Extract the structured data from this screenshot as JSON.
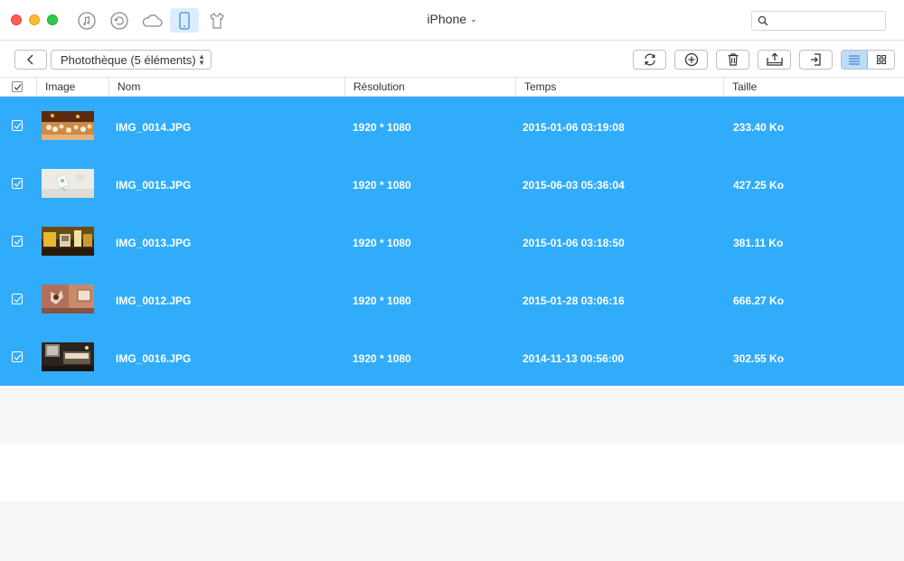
{
  "window": {
    "device_title": "iPhone",
    "search": {
      "placeholder": "",
      "value": ""
    },
    "nav_icons": [
      "itunes-icon",
      "restore-icon",
      "icloud-icon",
      "iphone-icon",
      "tshirt-icon"
    ],
    "active_nav": "iphone-icon"
  },
  "toolbar": {
    "library_selector": "Photothèque (5 éléments)",
    "buttons": [
      "back-icon",
      "refresh-icon",
      "add-icon",
      "trash-icon",
      "export-to-computer-icon",
      "import-icon",
      "list-view-icon",
      "grid-view-icon"
    ],
    "active_view": "list"
  },
  "table": {
    "columns": {
      "image": "Image",
      "name": "Nom",
      "resolution": "Résolution",
      "time": "Temps",
      "size": "Taille"
    },
    "all_selected": true,
    "rows": [
      {
        "name": "IMG_0014.JPG",
        "resolution": "1920 * 1080",
        "time": "2015-01-06 03:19:08",
        "size": "233.40 Ko",
        "selected": true
      },
      {
        "name": "IMG_0015.JPG",
        "resolution": "1920 * 1080",
        "time": "2015-06-03 05:36:04",
        "size": "427.25 Ko",
        "selected": true
      },
      {
        "name": "IMG_0013.JPG",
        "resolution": "1920 * 1080",
        "time": "2015-01-06 03:18:50",
        "size": "381.11 Ko",
        "selected": true
      },
      {
        "name": "IMG_0012.JPG",
        "resolution": "1920 * 1080",
        "time": "2015-01-28 03:06:16",
        "size": "666.27 Ko",
        "selected": true
      },
      {
        "name": "IMG_0016.JPG",
        "resolution": "1920 * 1080",
        "time": "2014-11-13 00:56:00",
        "size": "302.55 Ko",
        "selected": true
      }
    ]
  },
  "colors": {
    "selection": "#31acfb",
    "active_nav_bg": "#dcecfb",
    "active_view_bg": "#bcdcf9"
  }
}
